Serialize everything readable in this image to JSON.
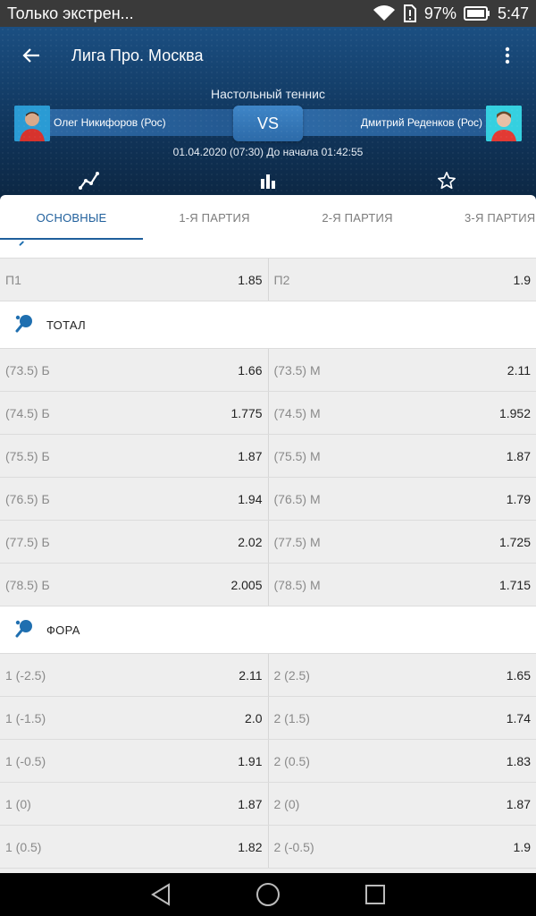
{
  "status_bar": {
    "notification": "Только экстрен...",
    "battery": "97%",
    "time": "5:47"
  },
  "header": {
    "title": "Лига Про. Москва",
    "sport": "Настольный теннис",
    "team1": "Олег Никифоров (Рос)",
    "team2": "Дмитрий Реденков (Рос)",
    "vs": "VS",
    "datetime": "01.04.2020 (07:30) До начала 01:42:55"
  },
  "tabs": [
    "ОСНОВНЫЕ",
    "1-Я ПАРТИЯ",
    "2-Я ПАРТИЯ",
    "3-Я ПАРТИЯ"
  ],
  "result_row": {
    "left_name": "П1",
    "left_odd": "1.85",
    "right_name": "П2",
    "right_odd": "1.9"
  },
  "sections": {
    "total": {
      "label": "ТОТАЛ",
      "rows": [
        {
          "left_name": "(73.5) Б",
          "left_odd": "1.66",
          "right_name": "(73.5) М",
          "right_odd": "2.11"
        },
        {
          "left_name": "(74.5) Б",
          "left_odd": "1.775",
          "right_name": "(74.5) М",
          "right_odd": "1.952"
        },
        {
          "left_name": "(75.5) Б",
          "left_odd": "1.87",
          "right_name": "(75.5) М",
          "right_odd": "1.87"
        },
        {
          "left_name": "(76.5) Б",
          "left_odd": "1.94",
          "right_name": "(76.5) М",
          "right_odd": "1.79"
        },
        {
          "left_name": "(77.5) Б",
          "left_odd": "2.02",
          "right_name": "(77.5) М",
          "right_odd": "1.725"
        },
        {
          "left_name": "(78.5) Б",
          "left_odd": "2.005",
          "right_name": "(78.5) М",
          "right_odd": "1.715"
        }
      ]
    },
    "handicap": {
      "label": "ФОРА",
      "rows": [
        {
          "left_name": "1 (-2.5)",
          "left_odd": "2.11",
          "right_name": "2 (2.5)",
          "right_odd": "1.65"
        },
        {
          "left_name": "1 (-1.5)",
          "left_odd": "2.0",
          "right_name": "2 (1.5)",
          "right_odd": "1.74"
        },
        {
          "left_name": "1 (-0.5)",
          "left_odd": "1.91",
          "right_name": "2 (0.5)",
          "right_odd": "1.83"
        },
        {
          "left_name": "1 (0)",
          "left_odd": "1.87",
          "right_name": "2 (0)",
          "right_odd": "1.87"
        },
        {
          "left_name": "1 (0.5)",
          "left_odd": "1.82",
          "right_name": "2 (-0.5)",
          "right_odd": "1.9"
        }
      ]
    }
  },
  "colors": {
    "accent": "#1f5f9c",
    "header_bg": "#123a63",
    "icon": "#1f6fb0"
  }
}
